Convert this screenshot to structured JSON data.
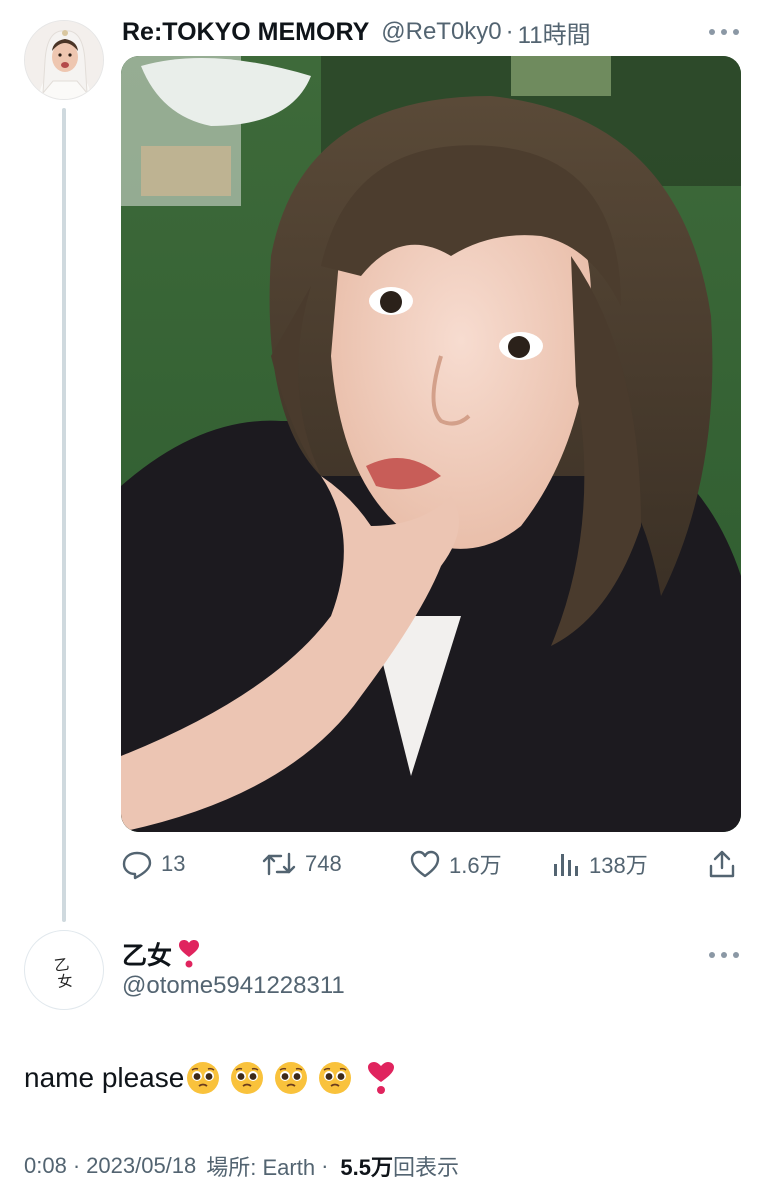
{
  "tweet": {
    "author": {
      "display_name": "Re:TOKYO MEMORY",
      "handle": "@ReT0ky0",
      "separator": "·",
      "time_ago": "11時間",
      "avatar_icon": "bride-avatar-icon"
    },
    "media": {
      "description_icon": "photo"
    },
    "actions": {
      "reply_count": "13",
      "retweet_count": "748",
      "like_count": "1.6万",
      "view_count": "138万",
      "icons": [
        "reply-icon",
        "retweet-icon",
        "like-icon",
        "views-icon",
        "share-icon"
      ]
    }
  },
  "reply": {
    "author": {
      "display_name": "乙女",
      "handle": "@otome5941228311",
      "avatar_text": "乙女"
    },
    "body_text": "name please",
    "emoji_sequence": [
      "pleading-face",
      "pleading-face",
      "pleading-face",
      "pleading-face",
      "heart-exclamation"
    ],
    "meta": {
      "time": "0:08",
      "date": "2023/05/18",
      "location_label": "場所: Earth",
      "separator": "·",
      "views_count": "5.5万",
      "views_label": "回表示"
    }
  },
  "colors": {
    "text_primary": "#0f1419",
    "text_secondary": "#536471",
    "thread_line": "#cfd9de",
    "heart_red": "#e0245e"
  }
}
